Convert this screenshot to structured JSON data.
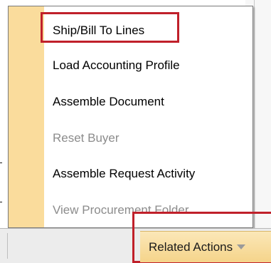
{
  "menu": {
    "items": [
      {
        "label": "Ship/Bill To Lines",
        "enabled": true,
        "highlighted": true
      },
      {
        "label": "Load Accounting Profile",
        "enabled": true
      },
      {
        "label": "Assemble Document",
        "enabled": true
      },
      {
        "label": "Reset Buyer",
        "enabled": false
      },
      {
        "label": "Assemble Request Activity",
        "enabled": true
      },
      {
        "label": "View Procurement Folder",
        "enabled": false
      }
    ]
  },
  "actions": {
    "related_label": "Related Actions",
    "related_icon": "chevron-down-icon"
  },
  "colors": {
    "gutter": "#fadc9c",
    "highlight": "#c0202a",
    "disabled_text": "#8c8c8c",
    "button_face": "#f5d48a"
  }
}
